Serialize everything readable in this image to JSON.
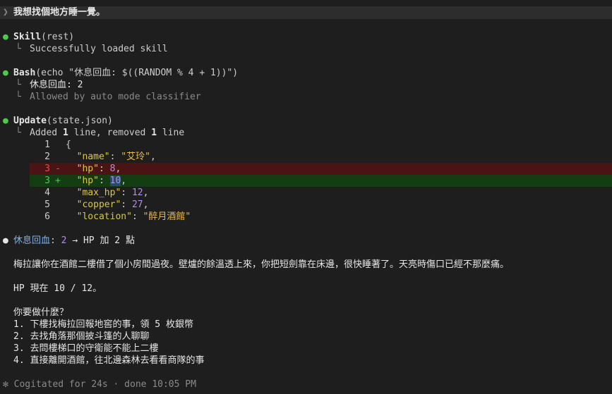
{
  "prompt": {
    "chevron": "❯",
    "text": "我想找個地方睡一覺。"
  },
  "tool_calls": [
    {
      "name": "Skill",
      "args": "(rest)",
      "results": [
        "Successfully loaded skill"
      ]
    },
    {
      "name": "Bash",
      "args": "(echo \"休息回血: $((RANDOM % 4 + 1))\")",
      "results": [
        "休息回血: 2",
        "Allowed by auto mode classifier"
      ]
    },
    {
      "name": "Update",
      "args": "(state.json)",
      "summary": {
        "prefix": "Added ",
        "added": "1",
        "mid": " line, removed ",
        "removed": "1",
        "suffix": " line"
      }
    }
  ],
  "diff": [
    {
      "ln": "1",
      "mark": "",
      "type": "ctx",
      "text": "{"
    },
    {
      "ln": "2",
      "mark": "",
      "type": "ctx",
      "key": "\"name\"",
      "sep": ": ",
      "val": "\"艾玲\"",
      "valtype": "str",
      "end": ","
    },
    {
      "ln": "3",
      "mark": "-",
      "type": "del",
      "key": "\"hp\"",
      "sep": ": ",
      "val": "8",
      "valtype": "num",
      "end": ","
    },
    {
      "ln": "3",
      "mark": "+",
      "type": "add",
      "key": "\"hp\"",
      "sep": ": ",
      "val": "10",
      "valtype": "num",
      "end": ","
    },
    {
      "ln": "4",
      "mark": "",
      "type": "ctx",
      "key": "\"max_hp\"",
      "sep": ": ",
      "val": "12",
      "valtype": "num",
      "end": ","
    },
    {
      "ln": "5",
      "mark": "",
      "type": "ctx",
      "key": "\"copper\"",
      "sep": ": ",
      "val": "27",
      "valtype": "num",
      "end": ","
    },
    {
      "ln": "6",
      "mark": "",
      "type": "ctx",
      "key": "\"location\"",
      "sep": ": ",
      "val": "\"醉月酒館\"",
      "valtype": "str",
      "end": ""
    }
  ],
  "response": {
    "heading_label": "休息回血",
    "heading_sep": ": ",
    "heading_num": "2",
    "heading_rest": " → HP 加 2 點",
    "narrative": "梅拉讓你在酒館二樓借了個小房間過夜。壁爐的餘溫透上來，你把短劍靠在床邊，很快睡著了。天亮時傷口已經不那麼痛。",
    "hp_line": "HP 現在 10 / 12。",
    "question": "你要做什麼？",
    "options": [
      "1. 下樓找梅拉回報地窖的事，領 5 枚銀幣",
      "2. 去找角落那個披斗篷的人聊聊",
      "3. 去問樓梯口的守衛能不能上二樓",
      "4. 直接離開酒館，往北邊森林去看看商隊的事"
    ]
  },
  "footer": "✻ Cogitated for 24s · done 10:05 PM",
  "colors": {
    "background": "#1e1e1e",
    "bullet_green": "#4ec94e",
    "diff_del_bg": "#4b1414",
    "diff_add_bg": "#143d14",
    "json_key": "#d6c84a",
    "json_string": "#e8b84c",
    "json_number": "#b48ee0",
    "summary_label": "#7fb0e8"
  }
}
